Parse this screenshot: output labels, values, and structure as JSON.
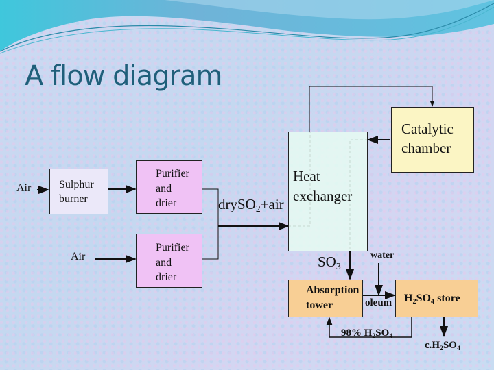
{
  "title": "A flow diagram",
  "colors": {
    "title": "#1f5f7a",
    "sulphur_burner": "#ebe8f9",
    "purifier": "#f0c2f5",
    "heat_exchanger": "#e6fbf2",
    "catalytic_chamber": "#fbf5c4",
    "absorption": "#f8cf95",
    "store": "#f8cf95"
  },
  "nodes": {
    "air_input_1": "Air",
    "sulphur_burner": [
      "Sulphur",
      "burner"
    ],
    "air_input_2": "Air",
    "purifier_1": [
      "Purifier",
      "and",
      "drier"
    ],
    "purifier_2": [
      "Purifier",
      "and",
      "drier"
    ],
    "heat_exchanger": [
      "Heat",
      "exchanger"
    ],
    "catalytic_chamber": [
      "Catalytic",
      "chamber"
    ],
    "absorption_tower": [
      "Absorption",
      "tower"
    ],
    "h2so4_store": {
      "prefix": "H",
      "sub1": "2",
      "mid": "SO",
      "sub2": "4",
      "suffix": " store"
    }
  },
  "edges": {
    "dry_so2_air": {
      "prefix": "dry",
      "mid": "SO",
      "sub": "2",
      "suffix": "+air"
    },
    "so3": {
      "prefix": "SO",
      "sub": "3"
    },
    "water": "water",
    "oleum": "oleum",
    "recycle_98": {
      "prefix": "98% H",
      "sub1": "2",
      "mid": "SO",
      "sub2": "4"
    },
    "product": {
      "prefix": "c.H",
      "sub1": "2",
      "mid": "SO",
      "sub2": "4"
    }
  }
}
